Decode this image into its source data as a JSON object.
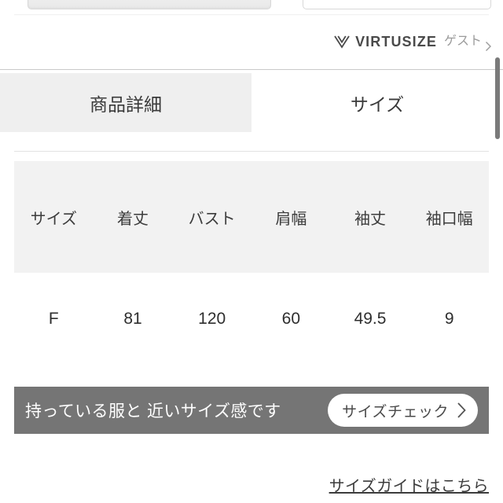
{
  "top_partial_card": {
    "fields": [
      {
        "name": "left-input",
        "value": "",
        "placeholder": ""
      },
      {
        "name": "right-input",
        "value": "",
        "placeholder": ""
      }
    ]
  },
  "brand": {
    "logo_icon": "virtusize-v-logo-icon",
    "wordmark": "VIRTUSIZE",
    "account_label": "ゲスト",
    "chevron_icon": "chevron-right-icon"
  },
  "tabs": [
    {
      "label": "商品詳細",
      "active": false
    },
    {
      "label": "サイズ",
      "active": true
    }
  ],
  "size_table": {
    "headers": [
      "サイズ",
      "着丈",
      "バスト",
      "肩幅",
      "袖丈",
      "袖口幅"
    ],
    "rows": [
      [
        "F",
        "81",
        "120",
        "60",
        "49.5",
        "9"
      ]
    ]
  },
  "cta": {
    "message": "持っている服と 近いサイズ感です",
    "button_label": "サイズチェック",
    "button_chevron_icon": "chevron-right-icon",
    "background_color": "#757575"
  },
  "footer": {
    "guide_link_label": "サイズガイドはこちら"
  },
  "scrollbar": {
    "orientation": "vertical",
    "thumb_color": "#7a7a7a"
  },
  "colors": {
    "tab_inactive_bg": "#efefef",
    "table_header_bg": "#f2f2f2",
    "cta_bg": "#757575",
    "text_primary": "#3c3c3c",
    "text_muted": "#9b9b9b"
  }
}
